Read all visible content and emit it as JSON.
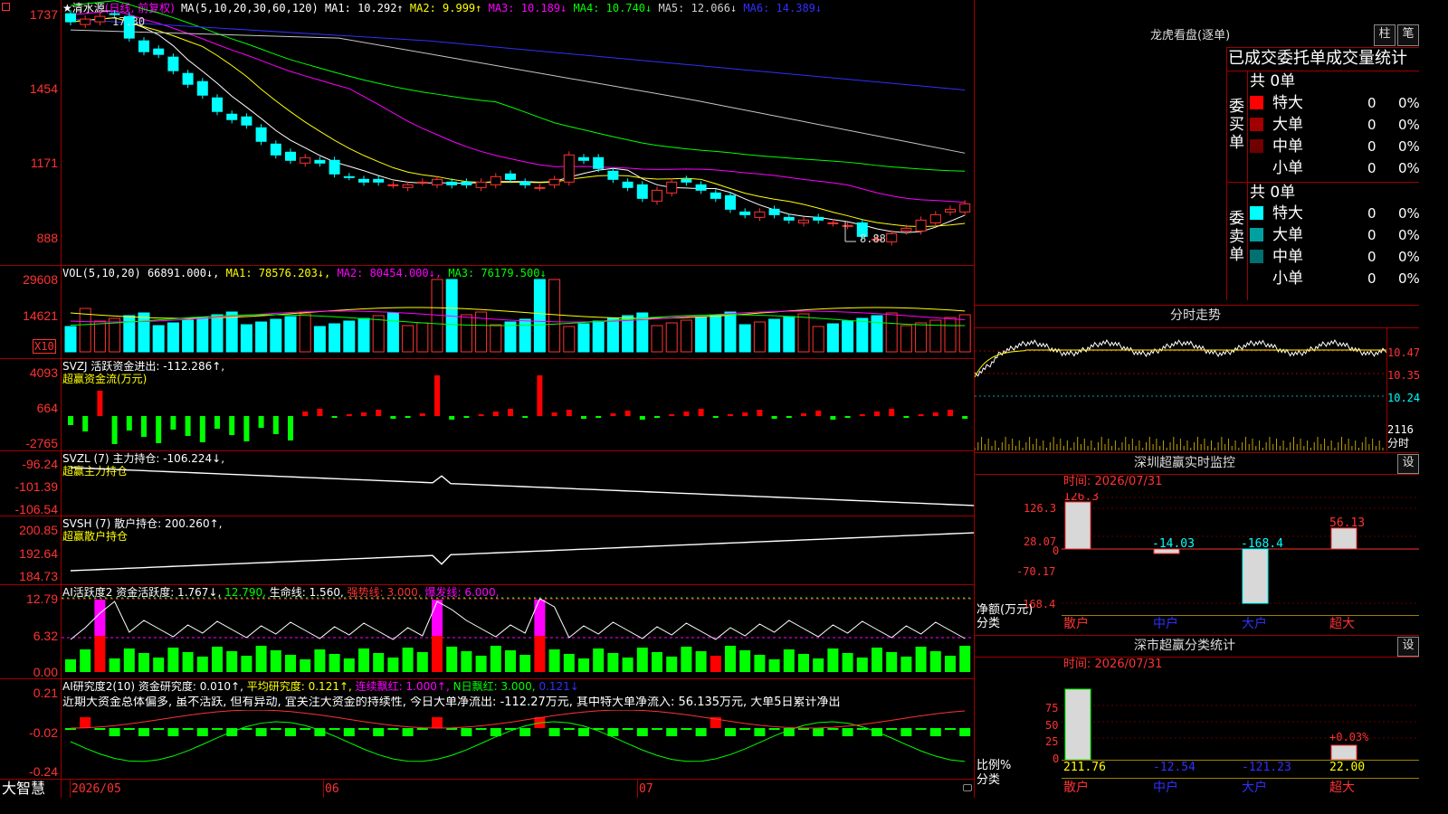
{
  "chart_header": {
    "name_prefix": "★清水源",
    "name_suffix": "(日线, 前复权)",
    "ma_def": "MA(5,10,20,30,60,120)",
    "ma": [
      {
        "label": "MA1: 10.292↑",
        "color": "#ffffff"
      },
      {
        "label": "MA2: 9.999↑",
        "color": "#ffff00"
      },
      {
        "label": "MA3: 10.189↓",
        "color": "#ff00ff"
      },
      {
        "label": "MA4: 10.740↓",
        "color": "#00ff00"
      },
      {
        "label": "MA5: 12.066↓",
        "color": "#d0d0d0"
      },
      {
        "label": "MA6: 14.389↓",
        "color": "#3030ff"
      }
    ]
  },
  "price_axis": [
    "1737",
    "1454",
    "1171",
    "888"
  ],
  "price_marks": {
    "high": "17.30",
    "low": "8.88"
  },
  "vol_header": {
    "def": "VOL(5,10,20)",
    "val": "66891.000↓,",
    "ma1": "MA1: 78576.203↓,",
    "ma2": "MA2: 80454.000↓,",
    "ma3": "MA3: 76179.500↓"
  },
  "vol_axis": [
    "29608",
    "14621",
    "X10"
  ],
  "svzj": {
    "label": "SVZJ  活跃资金进出: -112.286↑,",
    "sub": "超赢资金流(万元)",
    "axis": [
      "4093",
      "664",
      "-2765"
    ]
  },
  "svzl": {
    "label": "SVZL (7) 主力持仓: -106.224↓,",
    "sub": "超赢主力持仓",
    "axis": [
      "-96.24",
      "-101.39",
      "-106.54"
    ]
  },
  "svsh": {
    "label": "SVSH (7) 散户持仓: 200.260↑,",
    "sub": "超赢散户持仓",
    "axis": [
      "200.85",
      "192.64",
      "184.73"
    ]
  },
  "ai_active": {
    "parts": [
      {
        "text": "AI活跃度2 资金活跃度: 1.767↓,",
        "color": "#ffffff"
      },
      {
        "text": "12.790,",
        "color": "#00ff00"
      },
      {
        "text": "生命线: 1.560,",
        "color": "#ffffff"
      },
      {
        "text": "强势线: 3.000,",
        "color": "#ff3232"
      },
      {
        "text": "爆发线: 6.000,",
        "color": "#ff00ff"
      }
    ],
    "axis": [
      "12.79",
      "6.32",
      "0.00"
    ]
  },
  "ai_research": {
    "parts": [
      {
        "text": "AI研究度2(10) 资金研究度: 0.010↑,",
        "color": "#ffffff"
      },
      {
        "text": "平均研究度: 0.121↑,",
        "color": "#ffff00"
      },
      {
        "text": "连续飘红: 1.000↑,",
        "color": "#ff00ff"
      },
      {
        "text": "N日飘红: 3.000,",
        "color": "#00ff00"
      },
      {
        "text": "0.121↓",
        "color": "#3030ff"
      }
    ],
    "summary": "近期大资金总体偏多, 虽不活跃, 但有异动, 宜关注大资金的持续性, 今日大单净流出: -112.27万元, 其中特大单净流入: 56.135万元, 大单5日累计净出",
    "axis": [
      "0.21",
      "-0.02",
      "-0.24"
    ]
  },
  "bottom_bar": {
    "brand": "大智慧",
    "dates": [
      "2026/05",
      "06",
      "07"
    ]
  },
  "dragon": {
    "title": "龙虎看盘(逐单)",
    "btn_col": "柱",
    "btn_pen": "笔",
    "section_title": "已成交委托单成交量统计",
    "buy_label": "委买单",
    "sell_label": "委卖单",
    "buy_total": "共 0单",
    "sell_total": "共 0单",
    "buy_rows": [
      {
        "name": "特大",
        "qty": "0",
        "pct": "0%",
        "color": "#ff0000"
      },
      {
        "name": "大单",
        "qty": "0",
        "pct": "0%",
        "color": "#a00000"
      },
      {
        "name": "中单",
        "qty": "0",
        "pct": "0%",
        "color": "#700000"
      },
      {
        "name": "小单",
        "qty": "0",
        "pct": "0%",
        "color": ""
      }
    ],
    "sell_rows": [
      {
        "name": "特大",
        "qty": "0",
        "pct": "0%",
        "color": "#00ffff"
      },
      {
        "name": "大单",
        "qty": "0",
        "pct": "0%",
        "color": "#00a0a0"
      },
      {
        "name": "中单",
        "qty": "0",
        "pct": "0%",
        "color": "#007070"
      },
      {
        "name": "小单",
        "qty": "0",
        "pct": "0%",
        "color": ""
      }
    ]
  },
  "intraday": {
    "title": "分时走势",
    "axis": [
      "10.47",
      "10.35",
      "10.24",
      "2116"
    ],
    "time_label": "分时"
  },
  "sz_monitor": {
    "title": "深圳超赢实时监控",
    "settings": "设",
    "time": "时间: 2026/07/31",
    "axis": [
      "126.3",
      "28.07",
      "0",
      "-70.17",
      "-168.4"
    ],
    "values": [
      "126.3",
      "-14.03",
      "-168.4",
      "56.13"
    ],
    "y_label": "净额(万元)",
    "x_title": "分类",
    "categories": [
      "散户",
      "中户",
      "大户",
      "超大"
    ]
  },
  "sz_class": {
    "title": "深市超赢分类统计",
    "settings": "设",
    "time": "时间: 2026/07/31",
    "axis": [
      "75",
      "50",
      "25",
      "0"
    ],
    "values": [
      "211.76",
      "-12.54",
      "-121.23",
      "22.00"
    ],
    "pct_label": "+0.03%",
    "y_label": "比例%",
    "x_title": "分类",
    "categories": [
      "散户",
      "中户",
      "大户",
      "超大"
    ]
  },
  "chart_data": [
    {
      "type": "candlestick",
      "title": "★清水源(日线, 前复权)",
      "x_start": "2026/05",
      "ylim": [
        8.88,
        17.37
      ],
      "high": 17.3,
      "low": 8.88,
      "close": [
        16.9,
        17.0,
        17.1,
        17.2,
        16.3,
        15.8,
        15.7,
        15.1,
        14.6,
        14.2,
        13.6,
        13.3,
        13.1,
        12.5,
        12.0,
        11.8,
        11.9,
        11.7,
        11.3,
        11.2,
        11.0,
        11.0,
        10.9,
        10.9,
        11.0,
        11.1,
        10.9,
        10.9,
        11.0,
        11.2,
        11.1,
        10.9,
        10.8,
        11.1,
        12.0,
        11.8,
        11.5,
        11.1,
        10.8,
        10.4,
        10.7,
        11.0,
        11.0,
        10.7,
        10.4,
        10.0,
        9.8,
        9.9,
        9.8,
        9.6,
        9.6,
        9.6,
        9.5,
        9.4,
        9.0,
        8.9,
        9.1,
        9.3,
        9.6,
        9.8,
        10.0,
        10.2
      ],
      "ma_values": [
        10.292,
        9.999,
        10.189,
        10.74,
        12.066,
        14.389
      ]
    },
    {
      "type": "bar",
      "title": "VOL",
      "ma": [
        78576.203,
        80454.0,
        76179.5
      ],
      "last": 66891.0
    }
  ]
}
